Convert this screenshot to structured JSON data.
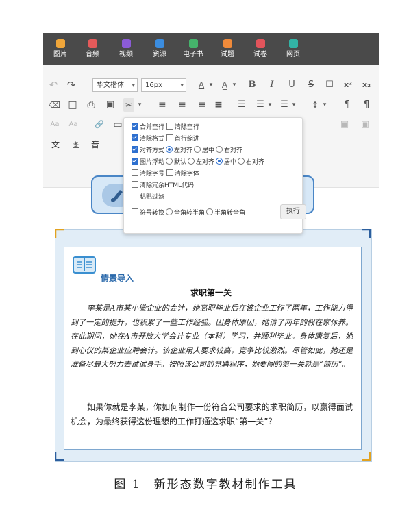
{
  "topbar": {
    "tools": [
      {
        "label": "图片",
        "color": "#f0a63a",
        "icon": "image-icon"
      },
      {
        "label": "音频",
        "color": "#e55a5a",
        "icon": "music-icon"
      },
      {
        "label": "视频",
        "color": "#8b5bd6",
        "icon": "video-icon"
      },
      {
        "label": "资源",
        "color": "#3b8de0",
        "icon": "resource-icon"
      },
      {
        "label": "电子书",
        "color": "#45b36b",
        "icon": "ebook-icon"
      },
      {
        "label": "试题",
        "color": "#f08a3a",
        "icon": "question-icon"
      },
      {
        "label": "试卷",
        "color": "#e2545b",
        "icon": "paper-icon"
      },
      {
        "label": "网页",
        "color": "#32b3a5",
        "icon": "web-icon"
      }
    ]
  },
  "toolbar": {
    "font_family": "华文楷体",
    "font_size": "16px",
    "glyphs": {
      "undo": "↶",
      "redo": "↷",
      "font_color": "A",
      "highlight": "A̲",
      "bold": "B",
      "italic": "I",
      "underline": "U",
      "strike": "S",
      "text_box": "☐",
      "superscript": "x²",
      "subscript": "x₂",
      "eraser": "⌫",
      "new_doc": "□",
      "print": "⎙",
      "preview": "▣",
      "magic": "✂",
      "align_left": "≡",
      "align_center": "≡",
      "align_right": "≡",
      "justify": "≡",
      "indent": "☰",
      "line_height": "↕",
      "paragraph_ltr": "¶",
      "paragraph_rtl": "¶",
      "link": "🔗",
      "picture": "▭",
      "text_mode": "文",
      "image_mode": "图",
      "audio_mode": "音",
      "case_a": "Aa",
      "case_b": "Aa",
      "dropdown": "▾"
    }
  },
  "autotypeset": {
    "options": [
      {
        "checked": true,
        "label": "合并空行",
        "extra": [
          {
            "type": "checkbox",
            "checked": false,
            "label": "清除空行"
          }
        ]
      },
      {
        "checked": true,
        "label": "清除格式",
        "extra": [
          {
            "type": "checkbox",
            "checked": false,
            "label": "首行缩进"
          }
        ]
      },
      {
        "checked": true,
        "label": "对齐方式",
        "extra": [
          {
            "type": "radio",
            "checked": true,
            "label": "左对齐"
          },
          {
            "type": "radio",
            "checked": false,
            "label": "居中"
          },
          {
            "type": "radio",
            "checked": false,
            "label": "右对齐"
          }
        ]
      },
      {
        "checked": true,
        "label": "图片浮动",
        "extra": [
          {
            "type": "radio",
            "checked": false,
            "label": "默认"
          },
          {
            "type": "radio",
            "checked": false,
            "label": "左对齐"
          },
          {
            "type": "radio",
            "checked": true,
            "label": "居中"
          },
          {
            "type": "radio",
            "checked": false,
            "label": "右对齐"
          }
        ]
      },
      {
        "checked": false,
        "label": "清除字号",
        "extra": [
          {
            "type": "checkbox",
            "checked": false,
            "label": "清除字体"
          }
        ]
      },
      {
        "checked": false,
        "label": "清除冗余HTML代码",
        "extra": []
      },
      {
        "checked": false,
        "label": "粘贴过滤",
        "extra": []
      },
      {
        "checked": false,
        "label": "符号转换",
        "extra": [
          {
            "type": "radio",
            "checked": false,
            "label": "全角转半角"
          },
          {
            "type": "radio",
            "checked": false,
            "label": "半角转全角"
          }
        ]
      }
    ],
    "execute_label": "执行"
  },
  "content": {
    "section_label": "情景导入",
    "title": "求职第一关",
    "paragraph1": "李某是A市某小微企业的会计，她高职毕业后在该企业工作了两年，工作能力得到了一定的提升，也积累了一些工作经验。因身体原因，她请了两年的假在家休养。在此期间，她在A市开放大学会计专业（本科）学习，并顺利毕业。身体康复后，她到心仪的某企业应聘会计。该企业用人要求较高，竞争比较激烈。尽管如此，她还是准备尽最大努力去试试身手。按照该公司的竞聘程序，她要闯的第一关就是“简历”。",
    "paragraph2": "如果你就是李某，你如何制作一份符合公司要求的求职简历，以赢得面试机会，为最终获得这份理想的工作打通这求职“第一关”？"
  },
  "colors": {
    "topbar_bg": "#4a4a4a",
    "accent_blue": "#2a69ab",
    "box_bg": "#e1edf7",
    "corner_gold": "#e2a21f",
    "corner_blue": "#2c5f9e"
  },
  "caption": "图 1　新形态数字教材制作工具"
}
